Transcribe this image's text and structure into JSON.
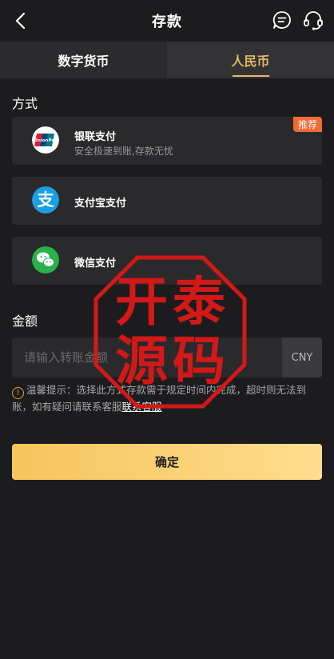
{
  "header": {
    "title": "存款"
  },
  "tabs": [
    {
      "label": "数字货币"
    },
    {
      "label": "人民币"
    }
  ],
  "method_section": {
    "label": "方式"
  },
  "methods": [
    {
      "name": "银联支付",
      "sub": "安全极速到账,存款无忧",
      "badge": "推荐",
      "logo_text": "UnionPay 银联",
      "icon": "unionpay-icon"
    },
    {
      "name": "支付宝支付",
      "icon": "alipay-icon",
      "logo_text": "支"
    },
    {
      "name": "微信支付",
      "icon": "wechat-icon"
    }
  ],
  "amount_section": {
    "label": "金额"
  },
  "amount": {
    "placeholder": "请输入转账金额",
    "currency": "CNY"
  },
  "tip": {
    "prefix": "温馨提示：选择此方式存款需于规定时间内完成，超时则无法到账，如有疑问请联系客服",
    "link": "联系客服"
  },
  "confirm_label": "确定",
  "watermark": {
    "chars": [
      "开",
      "泰",
      "源",
      "码"
    ]
  },
  "colors": {
    "accent": "#e2b866",
    "badge": "#f06a35",
    "watermark": "#d31818"
  }
}
